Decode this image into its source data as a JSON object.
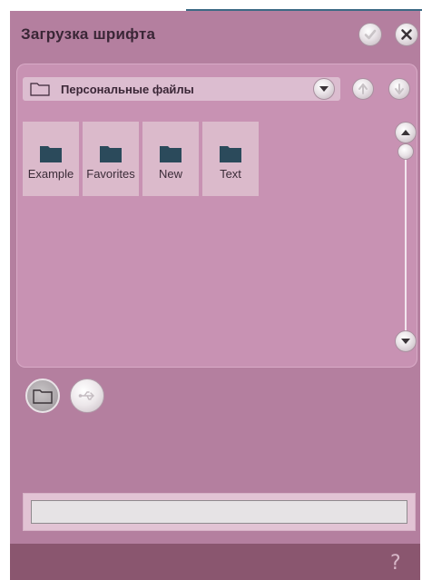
{
  "window": {
    "title": "Загрузка шрифта",
    "ok_icon": "checkmark-icon",
    "close_icon": "close-icon"
  },
  "browser": {
    "path_label": "Персональные файлы",
    "items": [
      {
        "label": "Example",
        "icon": "folder-icon"
      },
      {
        "label": "Favorites",
        "icon": "folder-icon"
      },
      {
        "label": "New",
        "icon": "folder-icon"
      },
      {
        "label": "Text",
        "icon": "folder-icon"
      }
    ]
  },
  "sources": {
    "folder": {
      "icon": "folder-icon",
      "selected": true
    },
    "usb": {
      "icon": "usb-icon",
      "selected": false
    }
  },
  "name_field": {
    "value": ""
  },
  "help_icon": "help-icon",
  "colors": {
    "window_bg": "#b47f9f",
    "panel_bg": "#c892b3",
    "item_bg": "#dbbacb",
    "folder_icon": "#2b4a5b",
    "bottom_bar": "#8a566f"
  }
}
